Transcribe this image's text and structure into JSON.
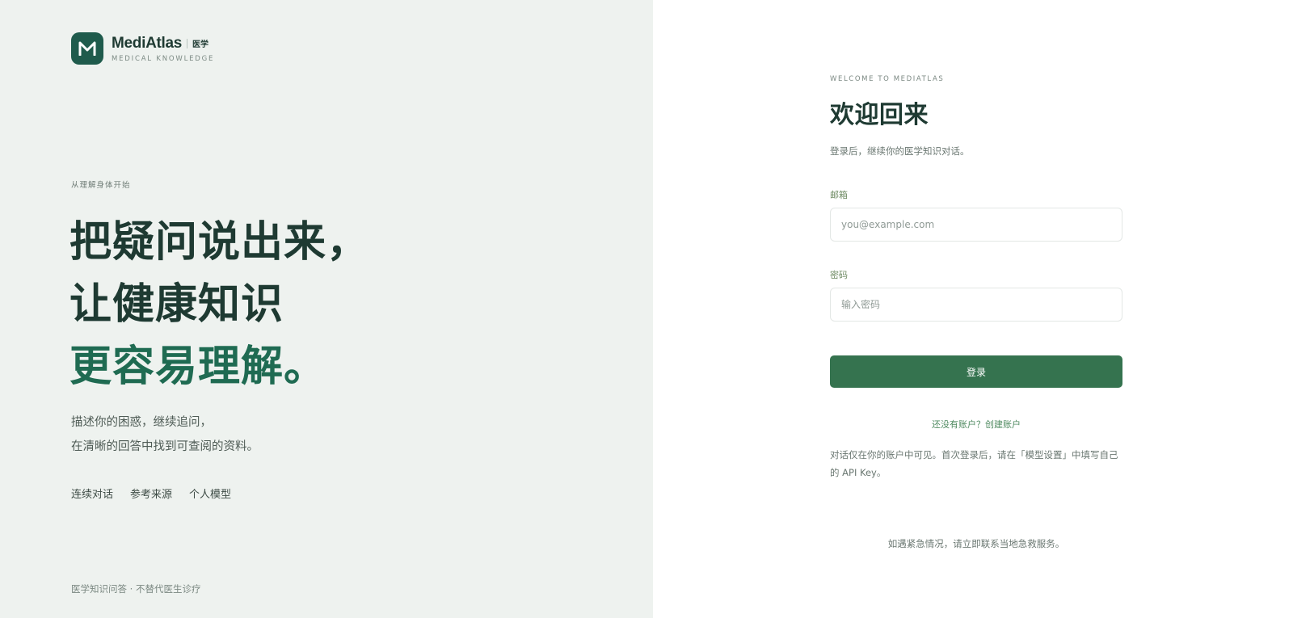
{
  "brand": {
    "name": "MediAtlas",
    "tag": "医学",
    "subtitle": "MEDICAL KNOWLEDGE",
    "logo_icon": "m-logo-icon",
    "color": "#1f5b4c"
  },
  "hero": {
    "eyebrow": "从理解身体开始",
    "headline": [
      "把疑问说出来，",
      "让健康知识",
      "更容易理解。"
    ],
    "headline_accent_color": "#1f6b52",
    "description": [
      "描述你的困惑，继续追问，",
      "在清晰的回答中找到可查阅的资料。"
    ],
    "features": [
      "连续对话",
      "参考来源",
      "个人模型"
    ],
    "disclaimer": "医学知识问答 · 不替代医生诊疗"
  },
  "login": {
    "eyebrow": "WELCOME TO MEDIATLAS",
    "title": "欢迎回来",
    "subtitle": "登录后，继续你的医学知识对话。",
    "email_label": "邮箱",
    "email_placeholder": "you@example.com",
    "email_value": "",
    "password_label": "密码",
    "password_placeholder": "输入密码",
    "password_value": "",
    "submit_label": "登录",
    "button_color": "#35734f",
    "signup_link": "还没有账户？创建账户",
    "privacy_note": "对话仅在你的账户中可见。首次登录后，请在「模型设置」中填写自己的 API Key。",
    "emergency_note": "如遇紧急情况，请立即联系当地急救服务。"
  }
}
